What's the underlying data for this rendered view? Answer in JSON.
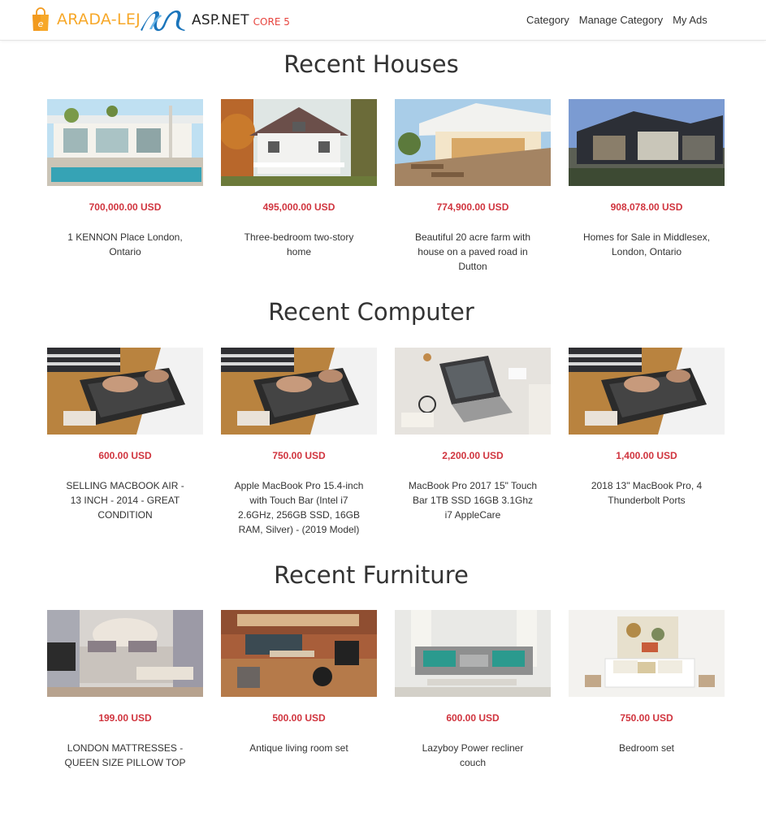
{
  "header": {
    "brand": "ARADA-LEJ",
    "framework": "ASP.NET",
    "framework_version": "CORE 5",
    "nav": [
      "Category",
      "Manage Category",
      "My Ads"
    ]
  },
  "sections": [
    {
      "title": "Recent Houses",
      "items": [
        {
          "price": "700,000.00 USD",
          "title": "1 KENNON Place London, Ontario",
          "image": "modern-house-pool"
        },
        {
          "price": "495,000.00 USD",
          "title": "Three-bedroom two-story home",
          "image": "white-two-story-house"
        },
        {
          "price": "774,900.00 USD",
          "title": "Beautiful 20 acre farm with house on a paved road in Dutton",
          "image": "house-deck-patio"
        },
        {
          "price": "908,078.00 USD",
          "title": "Homes for Sale in Middlesex, London, Ontario",
          "image": "contemporary-house"
        }
      ]
    },
    {
      "title": "Recent Computer",
      "items": [
        {
          "price": "600.00 USD",
          "title": "SELLING MACBOOK AIR - 13 INCH - 2014 - GREAT CONDITION",
          "image": "laptop-typing"
        },
        {
          "price": "750.00 USD",
          "title": "Apple MacBook Pro 15.4-inch with Touch Bar (Intel i7 2.6GHz, 256GB SSD, 16GB RAM, Silver) - (2019 Model)",
          "image": "laptop-typing"
        },
        {
          "price": "2,200.00 USD",
          "title": "MacBook Pro 2017 15\" Touch Bar 1TB SSD 16GB 3.1Ghz i7 AppleCare",
          "image": "laptop-desk-topdown"
        },
        {
          "price": "1,400.00 USD",
          "title": "2018 13\" MacBook Pro, 4 Thunderbolt Ports",
          "image": "laptop-typing"
        }
      ]
    },
    {
      "title": "Recent Furniture",
      "items": [
        {
          "price": "199.00 USD",
          "title": "LONDON MATTRESSES - QUEEN SIZE PILLOW TOP",
          "image": "bedroom-upholstered-bed"
        },
        {
          "price": "500.00 USD",
          "title": "Antique living room set",
          "image": "living-room-brick"
        },
        {
          "price": "600.00 USD",
          "title": "Lazyboy Power recliner couch",
          "image": "grey-sofa"
        },
        {
          "price": "750.00 USD",
          "title": "Bedroom set",
          "image": "white-bedroom-art"
        }
      ]
    }
  ],
  "colors": {
    "price": "#d0343e",
    "brand": "#f7a829",
    "aspnet_blue": "#1b75bb",
    "core": "#e7443e"
  }
}
